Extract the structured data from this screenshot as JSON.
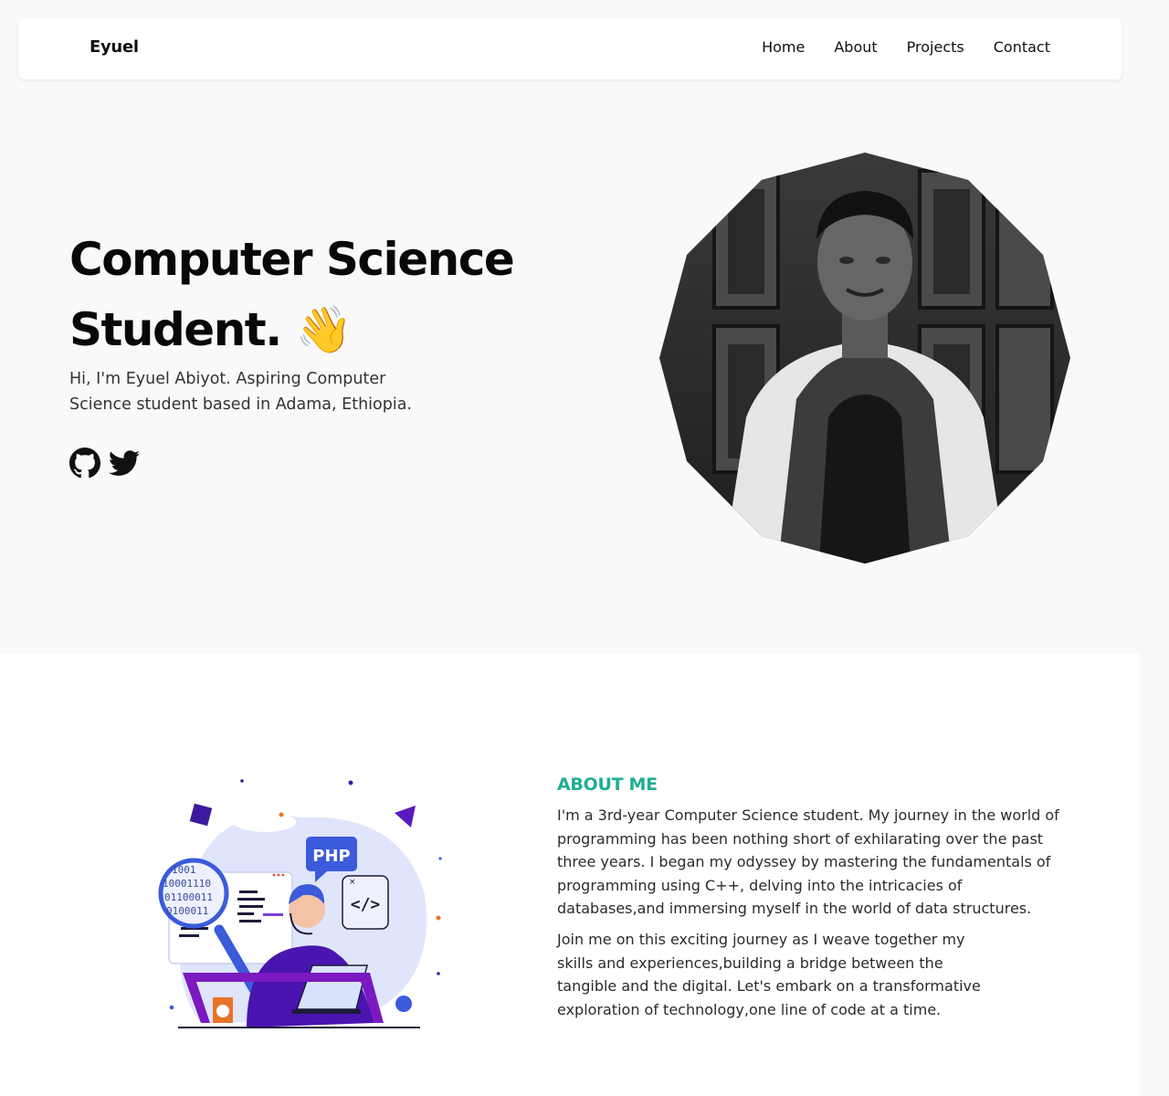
{
  "nav": {
    "logo": "Eyuel",
    "links": [
      "Home",
      "About",
      "Projects",
      "Contact"
    ]
  },
  "hero": {
    "title_line1": "Computer Science",
    "title_line2": "Student.",
    "wave_emoji": "👋",
    "subtitle": "Hi, I'm Eyuel Abiyot. Aspiring Computer Science student based in Adama, Ethiopia.",
    "socials": [
      "github-icon",
      "twitter-icon"
    ]
  },
  "about": {
    "heading": "ABOUT ME",
    "paragraph1": "I'm a 3rd-year Computer Science student. My journey in the world of programming has been nothing short of exhilarating over the past three years. I began my odyssey by mastering the fundamentals of programming using C++, delving into the intricacies of databases,and immersing myself in the world of data structures.",
    "paragraph2": "Join me on this exciting journey as I weave together my skills and experiences,building a bridge between the tangible and the digital. Let's embark on a transformative exploration of technology,one line of code at a time.",
    "illustration": {
      "php_label": "PHP",
      "code_label": "</>",
      "binary_lines": [
        "1001",
        "10001110",
        "01100011",
        "0100011"
      ]
    }
  },
  "colors": {
    "accent": "#1fae91",
    "purple": "#4a14b0",
    "blue": "#3b5bdb"
  }
}
